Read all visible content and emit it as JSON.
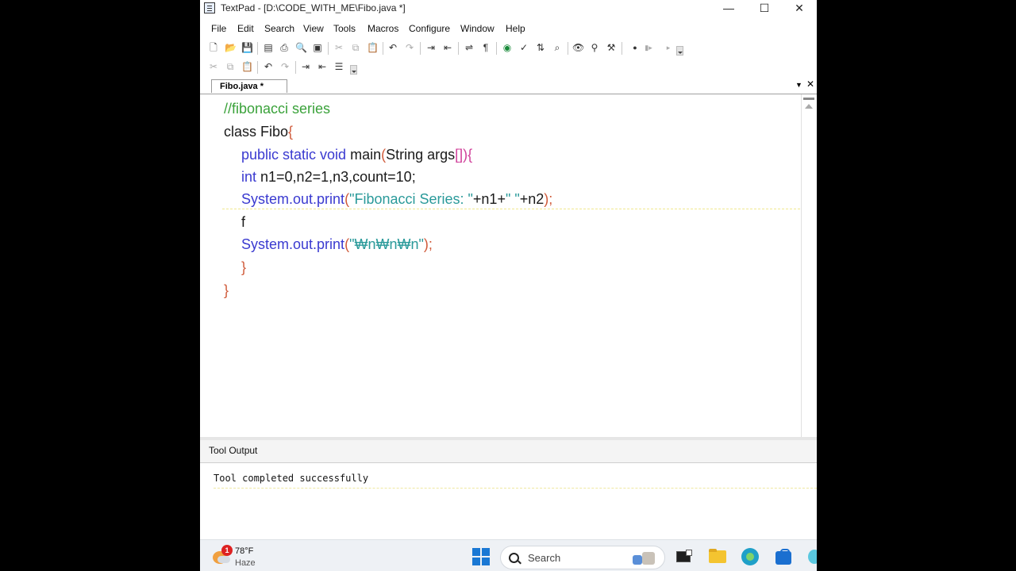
{
  "window": {
    "title": "TextPad - [D:\\CODE_WITH_ME\\Fibo.java *]",
    "min_glyph": "—",
    "max_glyph": "☐",
    "close_glyph": "✕"
  },
  "menu": [
    "File",
    "Edit",
    "Search",
    "View",
    "Tools",
    "Macros",
    "Configure",
    "Window",
    "Help"
  ],
  "toolbar1_icons": [
    "new-file",
    "open-file",
    "save",
    "sep",
    "save-all",
    "print",
    "print-preview",
    "spell",
    "sep",
    "cut",
    "copy",
    "paste",
    "sep",
    "undo",
    "redo",
    "sep",
    "indent",
    "unindent",
    "sep",
    "word-wrap",
    "pilcrow",
    "sep",
    "web",
    "spellcheck",
    "sort",
    "find",
    "sep",
    "find-replace",
    "replace-files",
    "tools",
    "sep",
    "record",
    "play",
    "step"
  ],
  "toolbar2_icons": [
    "cut",
    "copy",
    "paste",
    "sep",
    "undo",
    "redo",
    "sep",
    "indent",
    "unindent",
    "format"
  ],
  "tab": {
    "label": "Fibo.java *"
  },
  "code": {
    "line1": "//fibonacci series",
    "line2_kw": "class",
    "line2_name": " Fibo",
    "line2_brace": "{",
    "line3_kw": "public static void",
    "line3_fn": " main",
    "line3_paren": "(",
    "line3_arg": "String args",
    "line3_close": "[]){",
    "line4_kw": "int",
    "line4_rest": " n1=0,n2=1,n3,count=10;",
    "line5_a": "System.out.print",
    "line5_p": "(",
    "line5_str": "\"Fibonacci Series: \"",
    "line5_mid": "+n1+",
    "line5_str2": "\" \"",
    "line5_end": "+n2",
    "line5_close": ");",
    "line6": "f",
    "line7_a": "System.out.print",
    "line7_p": "(",
    "line7_str": "\"₩n₩n₩n\"",
    "line7_close": ");",
    "line8": "}",
    "line9": "}"
  },
  "tool_output": {
    "header": "Tool Output",
    "message": "Tool completed successfully"
  },
  "taskbar": {
    "weather_badge": "1",
    "temperature": "78°F",
    "condition": "Haze",
    "search_label": "Search"
  }
}
